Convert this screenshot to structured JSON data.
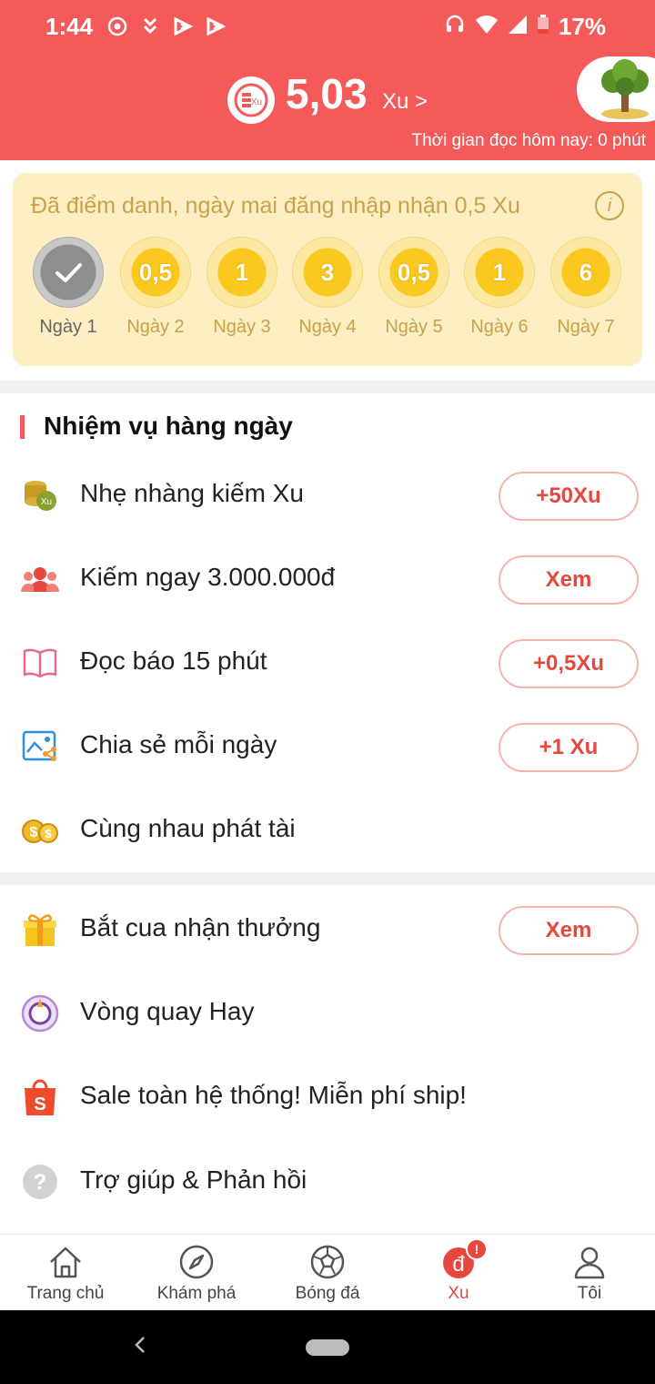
{
  "status_bar": {
    "time": "1:44",
    "battery": "17%"
  },
  "header": {
    "balance": "5,03",
    "unit": "Xu >",
    "coin_icon_text": "Xu",
    "read_time": "Thời gian đọc hôm nay: 0 phút"
  },
  "checkin": {
    "title": "Đã điểm danh, ngày mai đăng nhập nhận 0,5 Xu",
    "info_label": "i",
    "days": [
      {
        "label": "Ngày 1",
        "value": "",
        "done": true
      },
      {
        "label": "Ngày 2",
        "value": "0,5"
      },
      {
        "label": "Ngày 3",
        "value": "1"
      },
      {
        "label": "Ngày 4",
        "value": "3"
      },
      {
        "label": "Ngày 5",
        "value": "0,5"
      },
      {
        "label": "Ngày 6",
        "value": "1"
      },
      {
        "label": "Ngày 7",
        "value": "6"
      }
    ]
  },
  "daily_tasks": {
    "title": "Nhiệm vụ hàng ngày",
    "items": [
      {
        "label": "Nhẹ nhàng kiếm Xu",
        "button": "+50Xu",
        "icon": "coin-stack-icon"
      },
      {
        "label": "Kiếm ngay 3.000.000đ",
        "button": "Xem",
        "icon": "people-icon"
      },
      {
        "label": "Đọc báo 15 phút",
        "button": "+0,5Xu",
        "icon": "book-icon"
      },
      {
        "label": "Chia sẻ mỗi ngày",
        "button": "+1 Xu",
        "icon": "share-image-icon"
      },
      {
        "label": "Cùng nhau phát tài",
        "icon": "gold-coins-icon"
      }
    ]
  },
  "extras": {
    "items": [
      {
        "label": "Bắt cua nhận thưởng",
        "button": "Xem",
        "icon": "gift-icon"
      },
      {
        "label": "Vòng quay Hay",
        "icon": "wheel-icon"
      },
      {
        "label": "Sale toàn hệ thống! Miễn phí ship!",
        "icon": "shopping-bag-icon"
      },
      {
        "label": "Trợ giúp & Phản hồi",
        "icon": "help-icon"
      }
    ]
  },
  "tabbar": {
    "tabs": [
      {
        "label": "Trang chủ",
        "icon": "home-icon"
      },
      {
        "label": "Khám phá",
        "icon": "compass-icon"
      },
      {
        "label": "Bóng đá",
        "icon": "football-icon"
      },
      {
        "label": "Xu",
        "icon": "dong-icon",
        "active": true,
        "badge": "!"
      },
      {
        "label": "Tôi",
        "icon": "user-icon"
      }
    ]
  },
  "colors": {
    "brand": "#f45a5a",
    "accent": "#e8473d",
    "gold": "#c9a24a",
    "card_bg": "#fdeec3"
  }
}
